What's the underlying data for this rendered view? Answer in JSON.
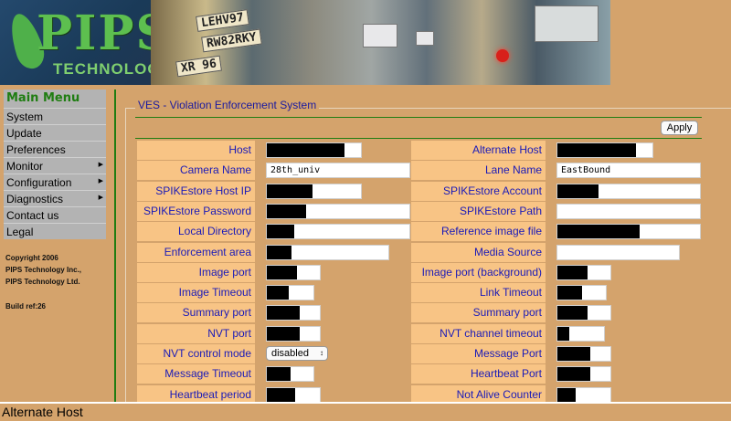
{
  "banner": {
    "logo_text": "PIPS",
    "logo_sub": "TECHNOLOGY",
    "plates": [
      "LEHV97",
      "RW82RKY",
      "XR 96"
    ]
  },
  "sidebar": {
    "title": "Main Menu",
    "items": [
      {
        "label": "System",
        "submenu": false
      },
      {
        "label": "Update",
        "submenu": false
      },
      {
        "label": "Preferences",
        "submenu": false
      },
      {
        "label": "Monitor",
        "submenu": true
      },
      {
        "label": "Configuration",
        "submenu": true
      },
      {
        "label": "Diagnostics",
        "submenu": true
      },
      {
        "label": "Contact us",
        "submenu": false
      },
      {
        "label": "Legal",
        "submenu": false
      }
    ],
    "copyright": [
      "Copyright 2006",
      "PIPS Technology Inc.,",
      "PIPS Technology Ltd."
    ],
    "build": "Build ref:26"
  },
  "main": {
    "legend": "VES - Violation Enforcement System",
    "apply_label": "Apply",
    "rows": [
      {
        "left": {
          "label": "Host",
          "value": "",
          "redacted": true
        },
        "right": {
          "label": "Alternate Host",
          "value": "",
          "redacted": true
        }
      },
      {
        "left": {
          "label": "Camera Name",
          "value": "28th_univ",
          "redacted": false
        },
        "right": {
          "label": "Lane Name",
          "value": "EastBound",
          "redacted": false
        }
      },
      {
        "left": {
          "label": "SPIKEstore Host IP",
          "value": "",
          "redacted": true
        },
        "right": {
          "label": "SPIKEstore Account",
          "value": "",
          "redacted": true
        }
      },
      {
        "left": {
          "label": "SPIKEstore Password",
          "value": "",
          "redacted": true
        },
        "right": {
          "label": "SPIKEstore Path",
          "value": "",
          "redacted": false
        }
      },
      {
        "left": {
          "label": "Local Directory",
          "value": "",
          "redacted": true
        },
        "right": {
          "label": "Reference image file",
          "value": "",
          "redacted": true
        }
      },
      {
        "left": {
          "label": "Enforcement area",
          "value": "",
          "redacted": true
        },
        "right": {
          "label": "Media Source",
          "value": "",
          "redacted": false
        }
      },
      {
        "left": {
          "label": "Image port",
          "value": "",
          "redacted": true
        },
        "right": {
          "label": "Image port (background)",
          "value": "",
          "redacted": true
        }
      },
      {
        "left": {
          "label": "Image Timeout",
          "value": "",
          "redacted": true
        },
        "right": {
          "label": "Link Timeout",
          "value": "",
          "redacted": true
        }
      },
      {
        "left": {
          "label": "Summary port",
          "value": "",
          "redacted": true
        },
        "right": {
          "label": "Summary port (background)",
          "value": "",
          "redacted": true
        }
      },
      {
        "left": {
          "label": "NVT port",
          "value": "",
          "redacted": true
        },
        "right": {
          "label": "NVT channel timeout",
          "value": "",
          "redacted": true
        }
      },
      {
        "left": {
          "label": "NVT control mode",
          "value": "disabled",
          "type": "select"
        },
        "right": {
          "label": "Message Port",
          "value": "",
          "redacted": true
        }
      },
      {
        "left": {
          "label": "Message Timeout",
          "value": "",
          "redacted": true
        },
        "right": {
          "label": "Heartbeat Port",
          "value": "",
          "redacted": true
        }
      },
      {
        "left": {
          "label": "Heartbeat period",
          "value": "",
          "redacted": true
        },
        "right": {
          "label": "Not Alive Counter",
          "value": "",
          "redacted": true
        }
      }
    ]
  },
  "statusbar": {
    "text": "Alternate Host"
  }
}
